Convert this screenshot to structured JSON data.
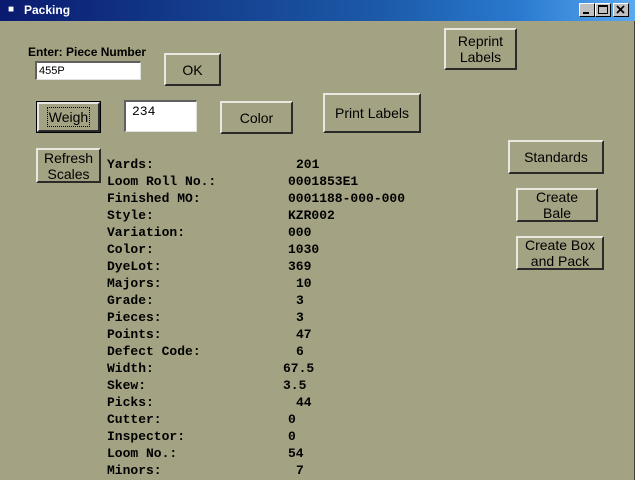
{
  "window": {
    "title": "Packing"
  },
  "piece": {
    "label": "Enter: Piece Number",
    "value": "455P"
  },
  "weight": {
    "value": "234"
  },
  "buttons": {
    "ok": "OK",
    "weigh": "Weigh",
    "color": "Color",
    "print_labels": "Print Labels",
    "reprint_labels": "Reprint\nLabels",
    "refresh_scales": "Refresh\nScales",
    "standards": "Standards",
    "create_bale": "Create\nBale",
    "create_box_and_pack": "Create Box\nand Pack"
  },
  "details": [
    {
      "label": "Yards:",
      "value": "201"
    },
    {
      "label": "Loom Roll No.:",
      "value": "0001853E1"
    },
    {
      "label": "Finished MO:",
      "value": "0001188-000-000"
    },
    {
      "label": "Style:",
      "value": "KZR002"
    },
    {
      "label": "Variation:",
      "value": "000"
    },
    {
      "label": "Color:",
      "value": "1030"
    },
    {
      "label": "DyeLot:",
      "value": "369"
    },
    {
      "label": "Majors:",
      "value": "10"
    },
    {
      "label": "Grade:",
      "value": "3"
    },
    {
      "label": "Pieces:",
      "value": "3"
    },
    {
      "label": "Points:",
      "value": "47"
    },
    {
      "label": "Defect Code:",
      "value": "6"
    },
    {
      "label": "Width:",
      "value": "67.5"
    },
    {
      "label": "Skew:",
      "value": "3.5"
    },
    {
      "label": "Picks:",
      "value": "44"
    },
    {
      "label": "Cutter:",
      "value": "0"
    },
    {
      "label": "Inspector:",
      "value": "0"
    },
    {
      "label": "Loom No.:",
      "value": "54"
    },
    {
      "label": "Minors:",
      "value": "7"
    }
  ]
}
